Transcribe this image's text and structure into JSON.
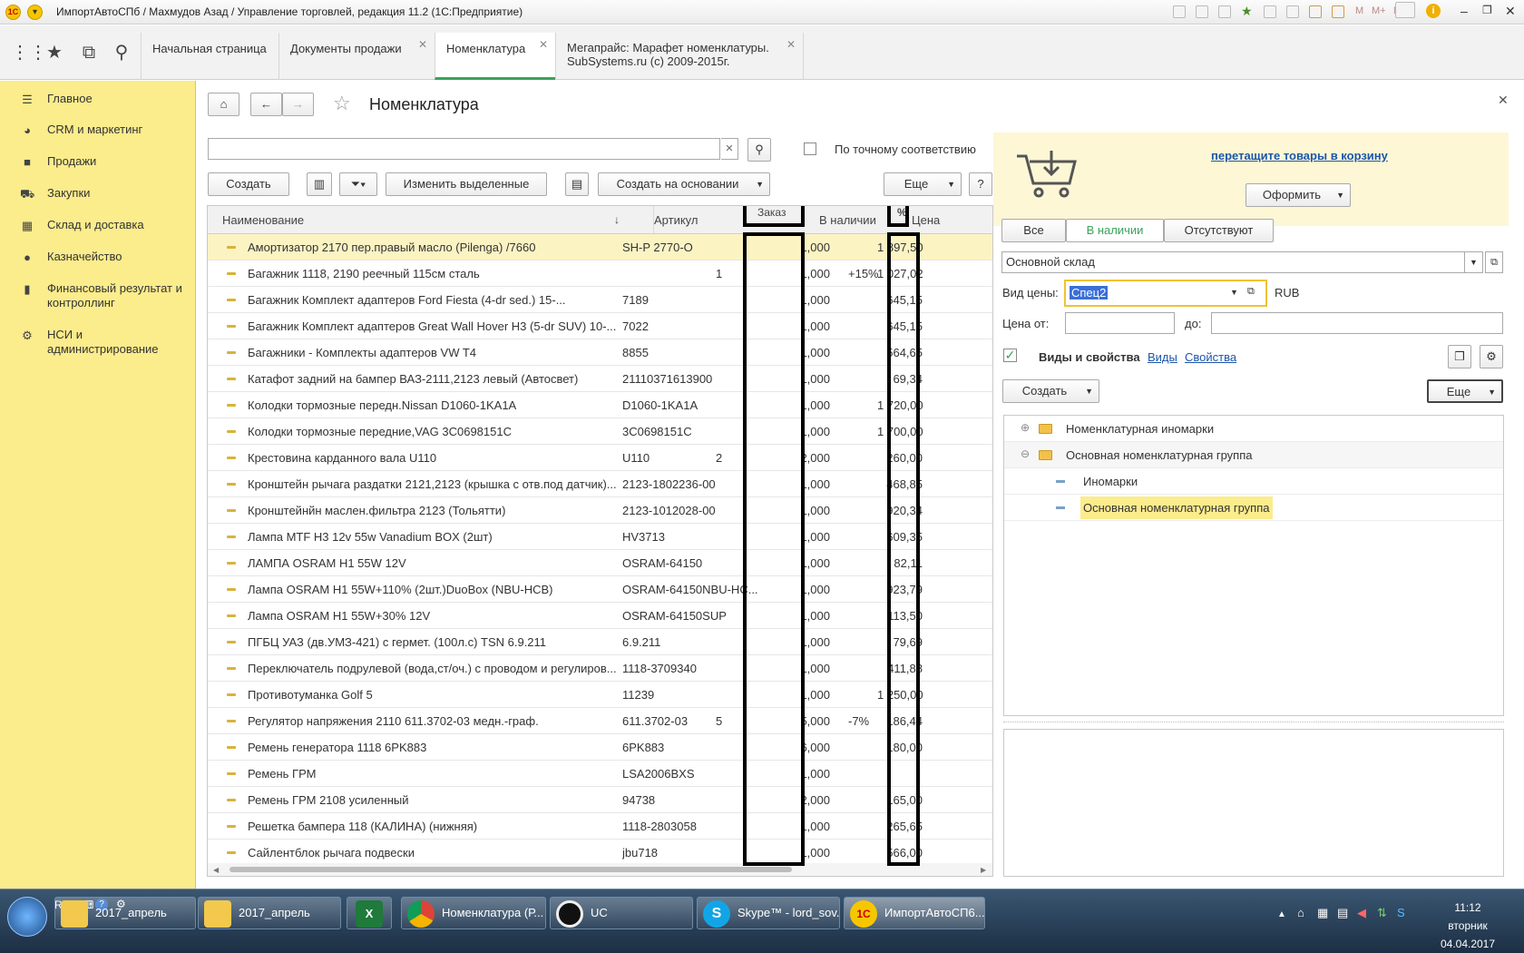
{
  "window": {
    "title": "ИмпортАвтоСПб / Махмудов Азад / Управление торговлей, редакция 11.2  (1С:Предприятие)"
  },
  "tabs": [
    {
      "label": "Начальная страница"
    },
    {
      "label": "Документы продажи"
    },
    {
      "label": "Номенклатура"
    },
    {
      "label_line1": "Мегапрайс: Марафет  номенклатуры.",
      "label_line2": "SubSystems.ru (c) 2009-2015г."
    }
  ],
  "sidebar": {
    "items": [
      {
        "label": "Главное",
        "icon": "menu-icon"
      },
      {
        "label": "CRM и маркетинг",
        "icon": "pie-icon"
      },
      {
        "label": "Продажи",
        "icon": "bag-icon"
      },
      {
        "label": "Закупки",
        "icon": "cart-icon"
      },
      {
        "label": "Склад и доставка",
        "icon": "warehouse-icon"
      },
      {
        "label": "Казначейство",
        "icon": "coin-icon"
      },
      {
        "label_line1": "Финансовый результат и",
        "label_line2": "контроллинг",
        "icon": "chart-icon"
      },
      {
        "label_line1": "НСИ и",
        "label_line2": "администрирование",
        "icon": "gear-icon"
      }
    ]
  },
  "page": {
    "title": "Номенклатура",
    "search_value": "",
    "exact_match_label": "По точному соответствию"
  },
  "toolbar": {
    "create": "Создать",
    "change_selected": "Изменить выделенные",
    "create_based_on": "Создать на основании",
    "more": "Еще",
    "help": "?"
  },
  "grid": {
    "headers": {
      "name": "Наименование",
      "article": "Артикул",
      "order": "Заказ",
      "stock": "В наличии",
      "percent": "%",
      "price": "Цена"
    },
    "rows": [
      {
        "name": "Амортизатор 2170 пер.правый масло (Pilenga) /7660",
        "article": "SH-P 2770-O",
        "order": "",
        "stock": "1,000",
        "pct": "",
        "price": "1 897,50"
      },
      {
        "name": "Багажник 1118, 2190 реечный 115см сталь",
        "article": "",
        "order": "1",
        "stock": "1,000",
        "pct": "+15%",
        "price": "1 027,02"
      },
      {
        "name": "Багажник Комплект адаптеров Ford Fiesta (4-dr sed.) 15-...",
        "article": "7189",
        "order": "",
        "stock": "1,000",
        "pct": "",
        "price": "645,15"
      },
      {
        "name": "Багажник Комплект адаптеров Great Wall Hover H3 (5-dr SUV) 10-...",
        "article": "7022",
        "order": "",
        "stock": "1,000",
        "pct": "",
        "price": "645,15"
      },
      {
        "name": "Багажники - Комплекты адаптеров VW T4",
        "article": "8855",
        "order": "",
        "stock": "1,000",
        "pct": "",
        "price": "564,65"
      },
      {
        "name": "Катафот задний на бампер ВАЗ-2111,2123 левый (Автосвет)",
        "article": "21110371613900",
        "order": "",
        "stock": "1,000",
        "pct": "",
        "price": "69,34"
      },
      {
        "name": "Колодки тормозные передн.Nissan D1060-1KA1A",
        "article": "D1060-1KA1A",
        "order": "",
        "stock": "1,000",
        "pct": "",
        "price": "1 720,00"
      },
      {
        "name": "Колодки тормозные передние,VAG 3C0698151C",
        "article": "3C0698151C",
        "order": "",
        "stock": "1,000",
        "pct": "",
        "price": "1 700,00"
      },
      {
        "name": "Крестовина карданного вала U110",
        "article": "U110",
        "order": "2",
        "stock": "2,000",
        "pct": "",
        "price": "260,00"
      },
      {
        "name": "Кронштейн рычага раздатки 2121,2123 (крышка с отв.под датчик)...",
        "article": "2123-1802236-00",
        "order": "",
        "stock": "1,000",
        "pct": "",
        "price": "468,85"
      },
      {
        "name": "Кронштейнйн маслен.фильтра 2123 (Тольятти)",
        "article": "2123-1012028-00",
        "order": "",
        "stock": "1,000",
        "pct": "",
        "price": "920,34"
      },
      {
        "name": "Лампа MTF H3 12v 55w Vanadium BOX (2шт)",
        "article": "HV3713",
        "order": "",
        "stock": "1,000",
        "pct": "",
        "price": "609,35"
      },
      {
        "name": "ЛАМПА OSRAM H1 55W 12V",
        "article": "OSRAM-64150",
        "order": "",
        "stock": "1,000",
        "pct": "",
        "price": "82,11"
      },
      {
        "name": "Лампа OSRAM H1 55W+110% (2шт.)DuoBox (NBU-HCB)",
        "article": "OSRAM-64150NBU-HC...",
        "order": "",
        "stock": "1,000",
        "pct": "",
        "price": "923,79"
      },
      {
        "name": "Лампа OSRAM H1 55W+30% 12V",
        "article": "OSRAM-64150SUP",
        "order": "",
        "stock": "1,000",
        "pct": "",
        "price": "113,50"
      },
      {
        "name": "ПГБЦ УАЗ (дв.УМЗ-421) с гермет. (100л.с) TSN 6.9.211",
        "article": "6.9.211",
        "order": "",
        "stock": "1,000",
        "pct": "",
        "price": "79,69"
      },
      {
        "name": "Переключатель подрулевой (вода,ст/оч.) с проводом и регулиров...",
        "article": "1118-3709340",
        "order": "",
        "stock": "1,000",
        "pct": "",
        "price": "411,88"
      },
      {
        "name": "Противотуманка Golf 5",
        "article": "11239",
        "order": "",
        "stock": "1,000",
        "pct": "",
        "price": "1 250,00"
      },
      {
        "name": "Регулятор напряжения 2110 611.3702-03 медн.-граф.",
        "article": "611.3702-03",
        "order": "5",
        "stock": "5,000",
        "pct": "-7%",
        "price": "186,44"
      },
      {
        "name": "Ремень генератора 1118 6PK883",
        "article": "6PK883",
        "order": "",
        "stock": "6,000",
        "pct": "",
        "price": "180,00"
      },
      {
        "name": "Ремень ГРМ",
        "article": "LSA2006BXS",
        "order": "",
        "stock": "1,000",
        "pct": "",
        "price": ""
      },
      {
        "name": "Ремень ГРМ 2108 усиленный",
        "article": "94738",
        "order": "",
        "stock": "2,000",
        "pct": "",
        "price": "165,00"
      },
      {
        "name": "Решетка бампера 118 (КАЛИНА) (нижняя)",
        "article": "1118-2803058",
        "order": "",
        "stock": "1,000",
        "pct": "",
        "price": "265,65"
      },
      {
        "name": "Сайлентблок рычага подвески",
        "article": "jbu718",
        "order": "",
        "stock": "1,000",
        "pct": "",
        "price": "566,00"
      }
    ]
  },
  "cart": {
    "drag_text": "перетащите товары в корзину",
    "checkout": "Оформить"
  },
  "filter_tabs": {
    "all": "Все",
    "in_stock": "В наличии",
    "absent": "Отсутствуют"
  },
  "warehouse": "Основной склад",
  "price_type": {
    "label": "Вид цены:",
    "value": "Спец2",
    "currency": "RUB"
  },
  "price_range": {
    "from_label": "Цена от:",
    "to_label": "до:"
  },
  "kinds": {
    "label": "Виды и свойства",
    "link_kinds": "Виды",
    "link_props": "Свойства"
  },
  "right_toolbar": {
    "create": "Создать",
    "more": "Еще"
  },
  "tree": [
    {
      "label": "Номенклатурная иномарки",
      "type": "folder",
      "toggle": "⊕"
    },
    {
      "label": "Основная номенклатурная группа",
      "type": "folder",
      "toggle": "⊖"
    },
    {
      "label": "Иномарки",
      "type": "item"
    },
    {
      "label": "Основная номенклатурная группа",
      "type": "item"
    }
  ],
  "taskbar": {
    "lang": "RU",
    "tasks": [
      "2017_апрель",
      "2017_апрель",
      "",
      "Номенклатура (Р...",
      "UC",
      "Skype™ - lord_sov...",
      "ИмпортАвтоСП6..."
    ],
    "clock": {
      "time": "11:12",
      "day": "вторник",
      "date": "04.04.2017"
    }
  },
  "colors": {
    "accent_green": "#3aa35b",
    "sidebar_yellow": "#fbec8c",
    "selection": "#fcf3c3"
  }
}
